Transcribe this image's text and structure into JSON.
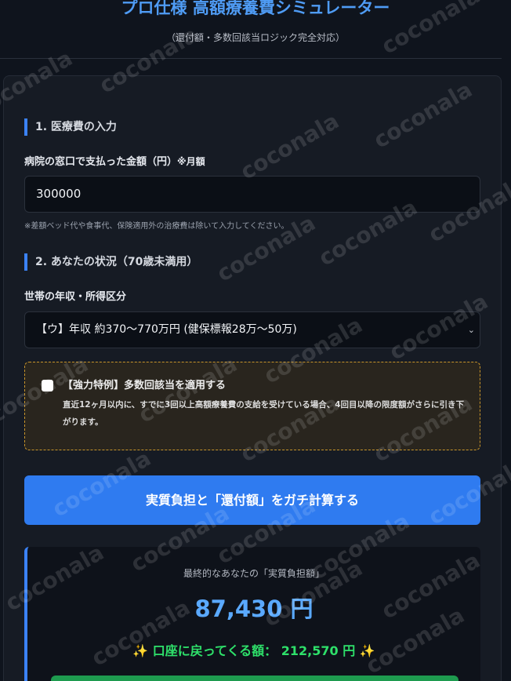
{
  "header": {
    "title": "プロ仕様 高額療養費シミュレーター",
    "subtitle": "（還付額・多数回該当ロジック完全対応）"
  },
  "section1": {
    "heading": "1. 医療費の入力",
    "field_label": "病院の窓口で支払った金額（円）",
    "field_suffix": "※月額",
    "value": "300000",
    "note": "※差額ベッド代や食事代、保険適用外の治療費は除いて入力してください。"
  },
  "section2": {
    "heading": "2. あなたの状況（70歳未満用）",
    "select_label": "世帯の年収・所得区分",
    "selected_option": "【ウ】年収 約370〜770万円 (健保標報28万〜50万)"
  },
  "special": {
    "checked": false,
    "title": "【強力特例】多数回該当を適用する",
    "description": "直近12ヶ月以内に、すでに3回以上高額療養費の支給を受けている場合、4回目以降の限度額がさらに引き下がります。"
  },
  "calc_button": {
    "label": "実質負担と「還付額」をガチ計算する"
  },
  "result": {
    "label": "最終的なあなたの「実質負担額」",
    "amount": "87,430 円",
    "refund_prefix": "口座に戻ってくる額：",
    "refund_amount": "212,570 円",
    "sparkle": "✨"
  },
  "watermark": {
    "text": "coconala"
  },
  "icons": {
    "chevron": "chevron-down-icon",
    "sparkle": "sparkle-icon"
  },
  "colors": {
    "accent": "#3b82f6",
    "button": "#2f7bf0",
    "result_amount": "#5aa9ff",
    "refund": "#2ee06a",
    "special_border": "#c8952b"
  }
}
